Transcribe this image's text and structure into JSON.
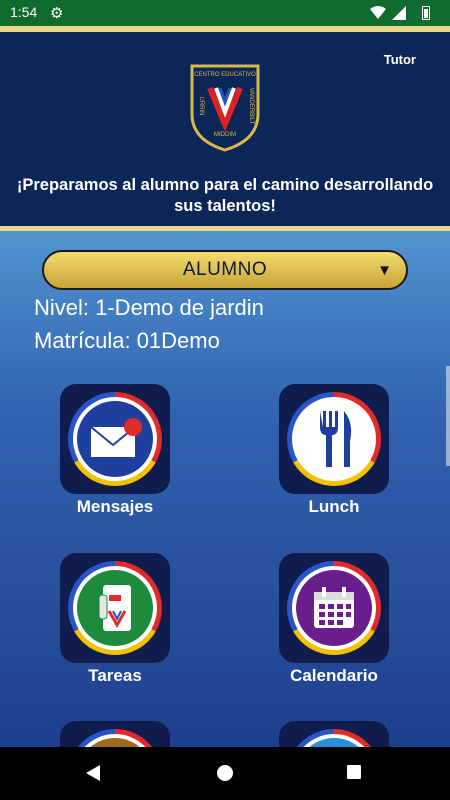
{
  "status_bar": {
    "time": "1:54",
    "icons": [
      "gear-icon",
      "wifi-icon",
      "signal-icon",
      "battery-icon"
    ]
  },
  "header": {
    "role": "Tutor",
    "logo": {
      "top_text": "CENTRO EDUCATIVO",
      "left_text": "URRIN",
      "right_text": "VANDERBILT",
      "bottom_text": "MIDDIM"
    },
    "slogan": "¡Preparamos al alumno para el camino desarrollando sus talentos!"
  },
  "selector": {
    "value": "ALUMNO"
  },
  "student": {
    "nivel": "Nivel: 1-Demo de jardin",
    "matricula": "Matrícula: 01Demo"
  },
  "menu": [
    {
      "label": "Mensajes",
      "icon": "envelope-icon"
    },
    {
      "label": "Lunch",
      "icon": "fork-knife-icon"
    },
    {
      "label": "Tareas",
      "icon": "notebook-icon"
    },
    {
      "label": "Calendario",
      "icon": "calendar-icon"
    }
  ],
  "colors": {
    "header_bg": "#0c2757",
    "accent_gold": "#e7d98a",
    "status_bar": "#0f6b2e"
  }
}
